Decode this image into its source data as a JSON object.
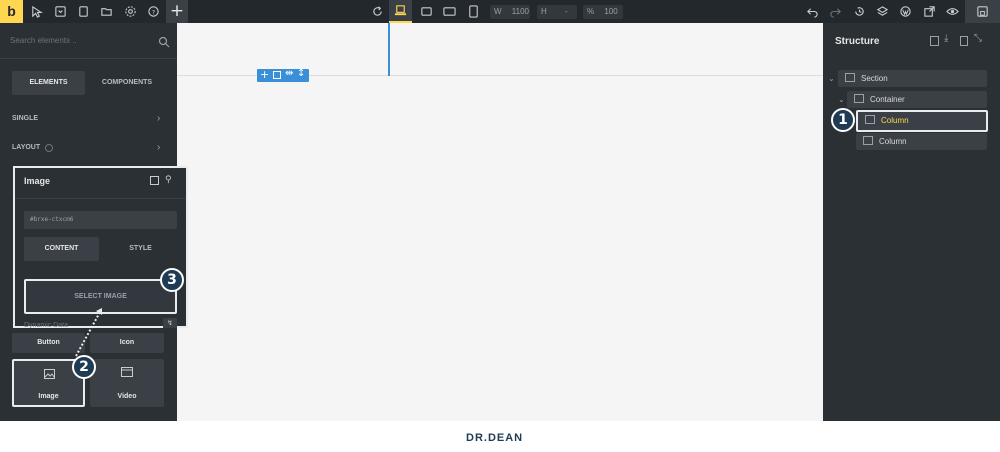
{
  "app": {
    "brand_letter": "b"
  },
  "toolbar": {
    "width_label": "W",
    "width_value": "1100",
    "height_label": "H",
    "height_value": "-",
    "zoom_label": "%",
    "zoom_value": "100"
  },
  "sidebar": {
    "search_placeholder": "Search elements ..",
    "tabs": [
      {
        "label": "ELEMENTS"
      },
      {
        "label": "COMPONENTS"
      }
    ],
    "groups": [
      {
        "label": "SINGLE"
      },
      {
        "label": "LAYOUT"
      }
    ],
    "elements": [
      {
        "label": "Button"
      },
      {
        "label": "Icon"
      },
      {
        "label": "Image"
      },
      {
        "label": "Video"
      }
    ]
  },
  "image_panel": {
    "title": "Image",
    "element_id": "#brxe-ctxcm6",
    "tabs": [
      {
        "label": "CONTENT"
      },
      {
        "label": "STYLE"
      }
    ],
    "select_image_label": "SELECT IMAGE",
    "dynamic_data_label": "Dynamic Data"
  },
  "structure": {
    "title": "Structure",
    "items": [
      {
        "label": "Section"
      },
      {
        "label": "Container"
      },
      {
        "label": "Column"
      },
      {
        "label": "Column"
      }
    ]
  },
  "callouts": [
    "1",
    "2",
    "3"
  ],
  "footer": {
    "logo_text": "DR.DEAN"
  },
  "colors": {
    "accent": "#ffd64f",
    "highlight": "#1f3b53",
    "selection_blue": "#3a8fd9",
    "dark_bg": "#2b3035"
  }
}
